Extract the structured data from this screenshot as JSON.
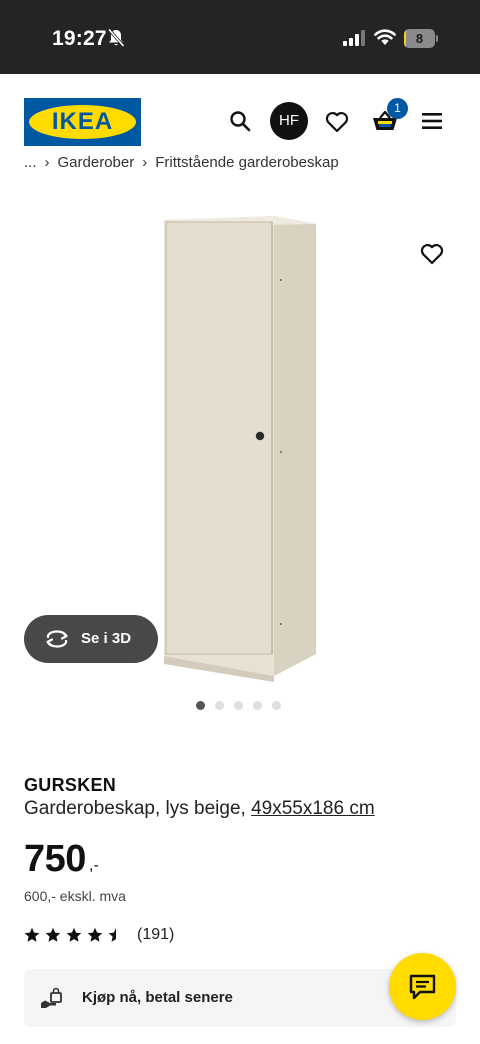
{
  "status_bar": {
    "time": "19:27",
    "battery_level": "8",
    "battery_fraction": 0.08,
    "icons": [
      "bell-slash-icon",
      "signal-icon",
      "wifi-icon",
      "battery-icon"
    ]
  },
  "header": {
    "logo_text": "IKEA",
    "avatar_initials": "HF",
    "cart_count": "1",
    "icons": [
      "search-icon",
      "heart-icon",
      "cart-icon",
      "menu-icon"
    ]
  },
  "breadcrumb": {
    "ellipsis": "...",
    "items": [
      "Garderober",
      "Frittstående garderobeskap"
    ]
  },
  "gallery": {
    "view3d_label": "Se i 3D",
    "image_count": 5,
    "active_index": 0
  },
  "product": {
    "name": "GURSKEN",
    "description": "Garderobeskap, lys beige, ",
    "size": "49x55x186 cm",
    "price": "750",
    "price_suffix": ",-",
    "price_ex_vat": "600,- ekskl. mva",
    "rating": 4.5,
    "reviews": "(191)"
  },
  "bnpl": {
    "label": "Kjøp nå, betal senere"
  },
  "colors": {
    "ikea_blue": "#0058a3",
    "ikea_yellow": "#ffdb00",
    "status_bar": "#242424",
    "button_dark": "#484848"
  }
}
